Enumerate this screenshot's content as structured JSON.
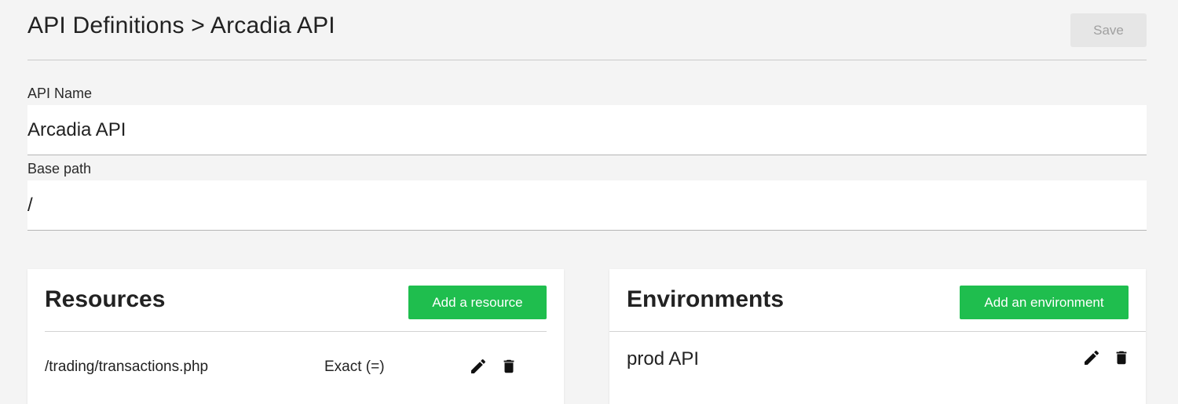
{
  "header": {
    "breadcrumb": "API Definitions > Arcadia API",
    "save_label": "Save"
  },
  "form": {
    "api_name": {
      "label": "API Name",
      "value": "Arcadia API"
    },
    "base_path": {
      "label": "Base path",
      "value": "/"
    }
  },
  "resources": {
    "title": "Resources",
    "add_label": "Add a resource",
    "items": [
      {
        "path": "/trading/transactions.php",
        "match": "Exact (=)"
      }
    ]
  },
  "environments": {
    "title": "Environments",
    "add_label": "Add an environment",
    "items": [
      {
        "name": "prod API"
      }
    ]
  },
  "colors": {
    "accent_green": "#1fbe4e",
    "page_bg": "#f4f4f4",
    "save_disabled_bg": "#e6e6e6"
  },
  "icons": [
    "pencil-icon",
    "trash-icon"
  ]
}
